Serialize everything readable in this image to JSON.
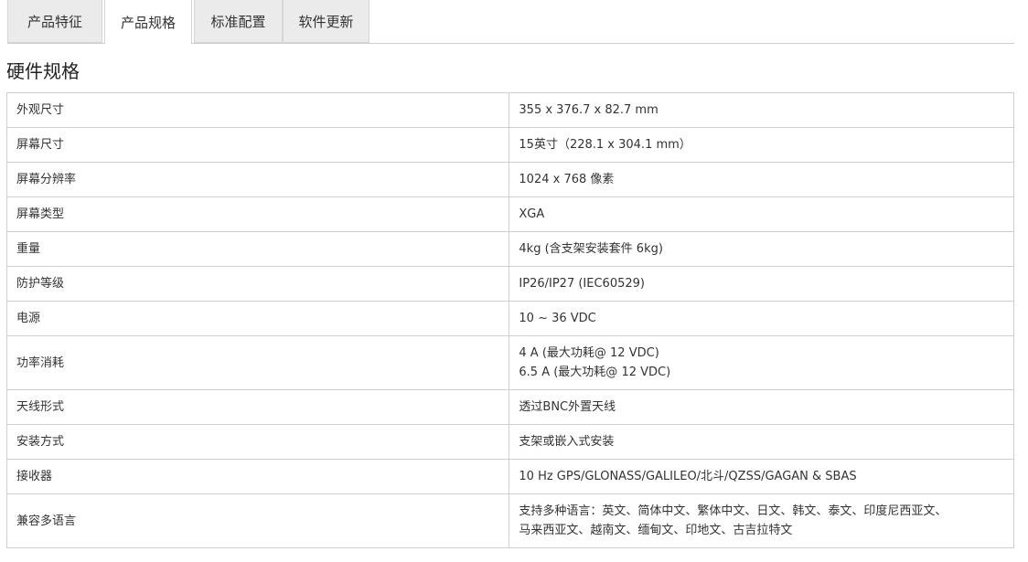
{
  "tabs": [
    {
      "label": "产品特征",
      "active": false
    },
    {
      "label": "产品规格",
      "active": true
    },
    {
      "label": "标准配置",
      "active": false
    },
    {
      "label": "软件更新",
      "active": false
    }
  ],
  "section_title": "硬件规格",
  "specs": [
    {
      "label": "外观尺寸",
      "value": [
        "355 x 376.7 x 82.7 mm"
      ]
    },
    {
      "label": "屏幕尺寸",
      "value": [
        "15英寸（228.1 x 304.1 mm）"
      ]
    },
    {
      "label": "屏幕分辨率",
      "value": [
        "1024 x 768 像素"
      ]
    },
    {
      "label": "屏幕类型",
      "value": [
        "XGA"
      ]
    },
    {
      "label": "重量",
      "value": [
        "4kg (含支架安装套件 6kg)"
      ]
    },
    {
      "label": "防护等级",
      "value": [
        "IP26/IP27 (IEC60529)"
      ]
    },
    {
      "label": "电源",
      "value": [
        "10 ~ 36 VDC"
      ]
    },
    {
      "label": "功率消耗",
      "value": [
        "4 A (最大功耗@ 12 VDC)",
        "6.5 A (最大功耗@ 12 VDC)"
      ]
    },
    {
      "label": "天线形式",
      "value": [
        "透过BNC外置天线"
      ]
    },
    {
      "label": "安装方式",
      "value": [
        "支架或嵌入式安装"
      ]
    },
    {
      "label": "接收器",
      "value": [
        "10 Hz GPS/GLONASS/GALILEO/北斗/QZSS/GAGAN & SBAS"
      ]
    },
    {
      "label": "兼容多语言",
      "value": [
        "支持多种语言：英文、简体中文、繁体中文、日文、韩文、泰文、印度尼西亚文、",
        "马来西亚文、越南文、缅甸文、印地文、古吉拉特文"
      ]
    }
  ]
}
